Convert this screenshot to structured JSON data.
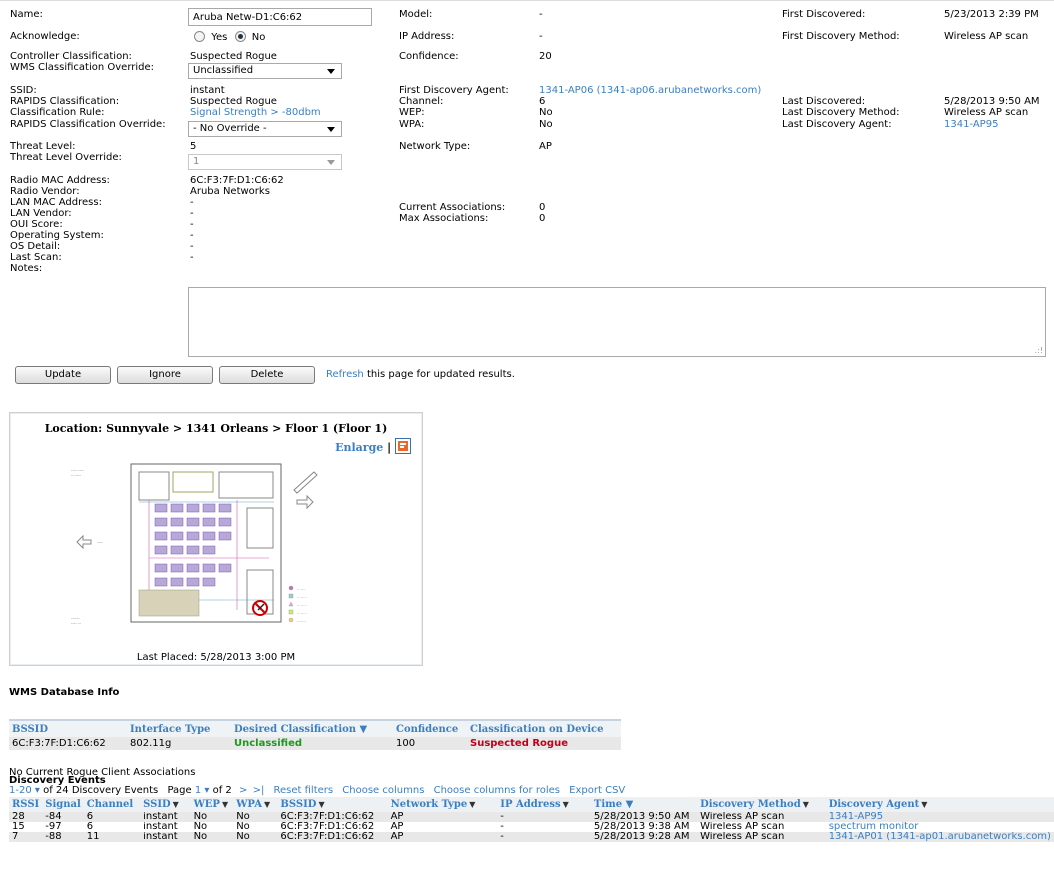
{
  "details": {
    "name_label": "Name:",
    "name_value": "Aruba Netw-D1:C6:62",
    "acknowledge_label": "Acknowledge:",
    "ack_yes": "Yes",
    "ack_no": "No",
    "controller_class_label": "Controller Classification:",
    "controller_class_value": "Suspected Rogue",
    "wms_override_label": "WMS Classification Override:",
    "wms_override_value": "Unclassified",
    "ssid_label": "SSID:",
    "ssid_value": "instant",
    "rapids_class_label": "RAPIDS Classification:",
    "rapids_class_value": "Suspected Rogue",
    "class_rule_label": "Classification Rule:",
    "class_rule_value": "Signal Strength > -80dbm",
    "rapids_override_label": "RAPIDS Classification Override:",
    "rapids_override_value": "- No Override -",
    "threat_level_label": "Threat Level:",
    "threat_level_value": "5",
    "threat_override_label": "Threat Level Override:",
    "threat_override_value": "1",
    "radio_mac_label": "Radio MAC Address:",
    "radio_mac_value": "6C:F3:7F:D1:C6:62",
    "radio_vendor_label": "Radio Vendor:",
    "radio_vendor_value": "Aruba Networks",
    "lan_mac_label": "LAN MAC Address:",
    "lan_mac_value": "-",
    "lan_vendor_label": "LAN Vendor:",
    "lan_vendor_value": "-",
    "oui_label": "OUI Score:",
    "oui_value": "-",
    "os_label": "Operating System:",
    "os_value": "-",
    "os_detail_label": "OS Detail:",
    "os_detail_value": "-",
    "last_scan_label": "Last Scan:",
    "last_scan_value": "-",
    "notes_label": "Notes:"
  },
  "middle": {
    "model_label": "Model:",
    "model_value": "-",
    "ip_label": "IP Address:",
    "ip_value": "-",
    "confidence_label": "Confidence:",
    "confidence_value": "20",
    "fda_label": "First Discovery Agent:",
    "fda_value": "1341-AP06 (1341-ap06.arubanetworks.com)",
    "channel_label": "Channel:",
    "channel_value": "6",
    "wep_label": "WEP:",
    "wep_value": "No",
    "wpa_label": "WPA:",
    "wpa_value": "No",
    "nettype_label": "Network Type:",
    "nettype_value": "AP",
    "cur_assoc_label": "Current Associations:",
    "cur_assoc_value": "0",
    "max_assoc_label": "Max Associations:",
    "max_assoc_value": "0"
  },
  "right": {
    "first_disc_label": "First Discovered:",
    "first_disc_value": "5/23/2013 2:39 PM",
    "first_method_label": "First Discovery Method:",
    "first_method_value": "Wireless AP scan",
    "last_disc_label": "Last Discovered:",
    "last_disc_value": "5/28/2013 9:50 AM",
    "last_method_label": "Last Discovery Method:",
    "last_method_value": "Wireless AP scan",
    "last_agent_label": "Last Discovery Agent:",
    "last_agent_value": "1341-AP95"
  },
  "actions": {
    "update": "Update",
    "ignore": "Ignore",
    "delete": "Delete",
    "refresh_link": "Refresh",
    "refresh_text": " this page for updated results."
  },
  "map": {
    "title": "Location: Sunnyvale > 1341 Orleans > Floor 1 (Floor 1)",
    "enlarge": "Enlarge",
    "sep": "|",
    "last_placed": "Last Placed: 5/28/2013 3:00 PM"
  },
  "wms": {
    "heading": "WMS Database Info",
    "headers": [
      "BSSID",
      "Interface Type",
      "Desired Classification ▼",
      "Confidence",
      "Classification on Device"
    ],
    "row": [
      "6C:F3:7F:D1:C6:62",
      "802.11g",
      "Unclassified",
      "100",
      "Suspected Rogue"
    ]
  },
  "assoc_note": "No Current Rogue Client Associations",
  "events": {
    "heading": "Discovery Events",
    "range": "1-20",
    "range_suffix": " of 24 Discovery Events",
    "page_label": "Page ",
    "page_num": "1",
    "of_pages": " of 2",
    "next": ">",
    "last": ">|",
    "reset_filters": "Reset filters",
    "choose_columns": "Choose columns",
    "choose_roles": "Choose columns for roles",
    "export": "Export CSV",
    "headers": [
      "RSSI",
      "Signal",
      "Channel",
      "SSID",
      "WEP",
      "WPA",
      "BSSID",
      "Network Type",
      "IP Address",
      "Time ▼",
      "Discovery Method",
      "Discovery Agent"
    ],
    "rows": [
      [
        "28",
        "-84",
        "6",
        "instant",
        "No",
        "No",
        "6C:F3:7F:D1:C6:62",
        "AP",
        "-",
        "5/28/2013 9:50 AM",
        "Wireless AP scan",
        "1341-AP95"
      ],
      [
        "15",
        "-97",
        "6",
        "instant",
        "No",
        "No",
        "6C:F3:7F:D1:C6:62",
        "AP",
        "-",
        "5/28/2013 9:38 AM",
        "Wireless AP scan",
        "spectrum monitor"
      ],
      [
        "7",
        "-88",
        "11",
        "instant",
        "No",
        "No",
        "6C:F3:7F:D1:C6:62",
        "AP",
        "-",
        "5/28/2013 9:28 AM",
        "Wireless AP scan",
        "1341-AP01 (1341-ap01.arubanetworks.com)"
      ]
    ]
  },
  "colors": {
    "link": "#3a7fc1",
    "green": "#1b9a1b",
    "red": "#c0001a"
  }
}
